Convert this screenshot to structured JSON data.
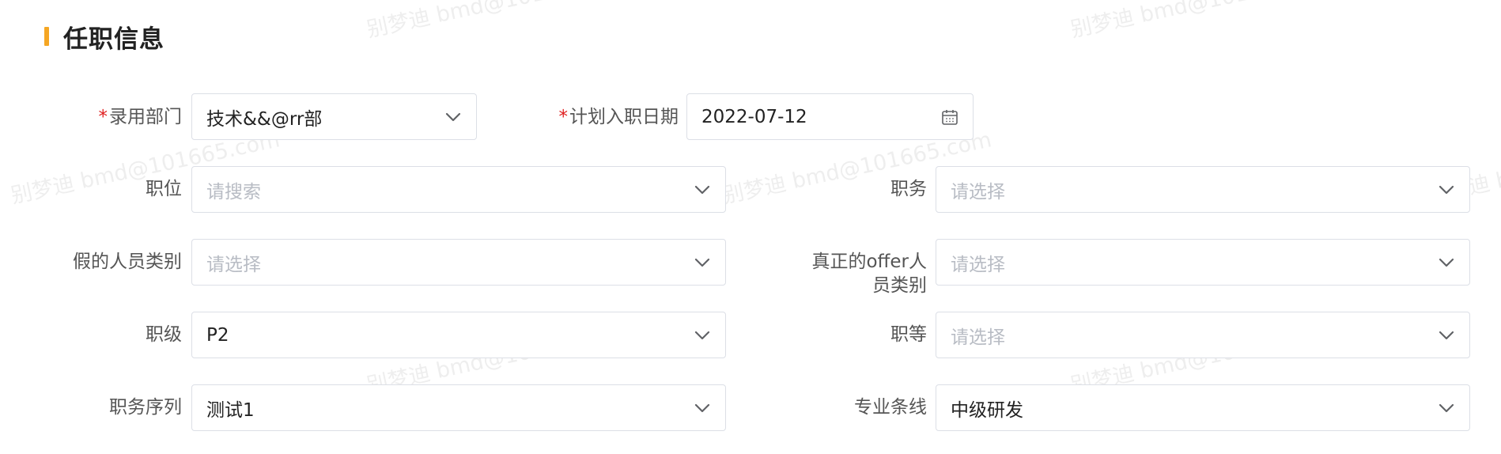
{
  "section": {
    "title": "任职信息"
  },
  "required_mark": "*",
  "watermark_text": "别梦迪 bmd@101665.com",
  "fields": {
    "department": {
      "label": "录用部门",
      "value": "技术&&@rr部"
    },
    "onboard_date": {
      "label": "计划入职日期",
      "value": "2022-07-12"
    },
    "position": {
      "label": "职位",
      "placeholder": "请搜索"
    },
    "duty": {
      "label": "职务",
      "placeholder": "请选择"
    },
    "fake_category": {
      "label": "假的人员类别",
      "placeholder": "请选择"
    },
    "offer_category": {
      "label_line1": "真正的offer人",
      "label_line2": "员类别",
      "placeholder": "请选择"
    },
    "rank": {
      "label": "职级",
      "value": "P2"
    },
    "grade": {
      "label": "职等",
      "placeholder": "请选择"
    },
    "duty_sequence": {
      "label": "职务序列",
      "value": "测试1"
    },
    "professional_line": {
      "label": "专业条线",
      "value": "中级研发"
    }
  },
  "icons": {
    "dropdown": "chevron-down-icon",
    "date": "calendar-icon"
  },
  "colors": {
    "accent": "#f5a623",
    "required": "#e02020",
    "border": "#dcdfe6",
    "placeholder": "#b8bcc4"
  }
}
